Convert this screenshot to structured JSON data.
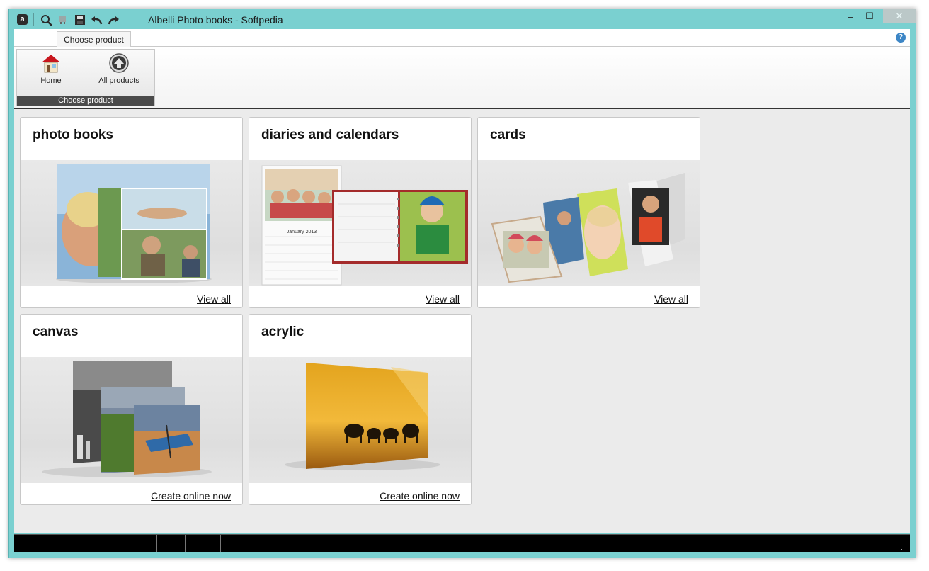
{
  "window": {
    "title": "Albelli Photo books - Softpedia",
    "controls": {
      "minimize": "–",
      "maximize": "☐",
      "close": "✕"
    }
  },
  "quick_access": {
    "logo": "a",
    "icons": [
      "search-icon",
      "cart-icon",
      "save-icon",
      "undo-icon",
      "redo-icon"
    ]
  },
  "ribbon": {
    "tab": "Choose product",
    "help": "?",
    "buttons": [
      {
        "label": "Home",
        "icon": "home-icon"
      },
      {
        "label": "All products",
        "icon": "up-arrow-icon"
      }
    ],
    "group_label": "Choose product"
  },
  "products": [
    {
      "title": "photo books",
      "link": "View all"
    },
    {
      "title": "diaries and calendars",
      "link": "View all"
    },
    {
      "title": "cards",
      "link": "View all"
    },
    {
      "title": "canvas",
      "link": "Create online now"
    },
    {
      "title": "acrylic",
      "link": "Create online now"
    }
  ],
  "calendar_caption": "January 2013",
  "colors": {
    "window_frame": "#7ad0d0",
    "content_bg": "#ebebeb",
    "statusbar": "#000000",
    "help_icon": "#3d86c6"
  }
}
